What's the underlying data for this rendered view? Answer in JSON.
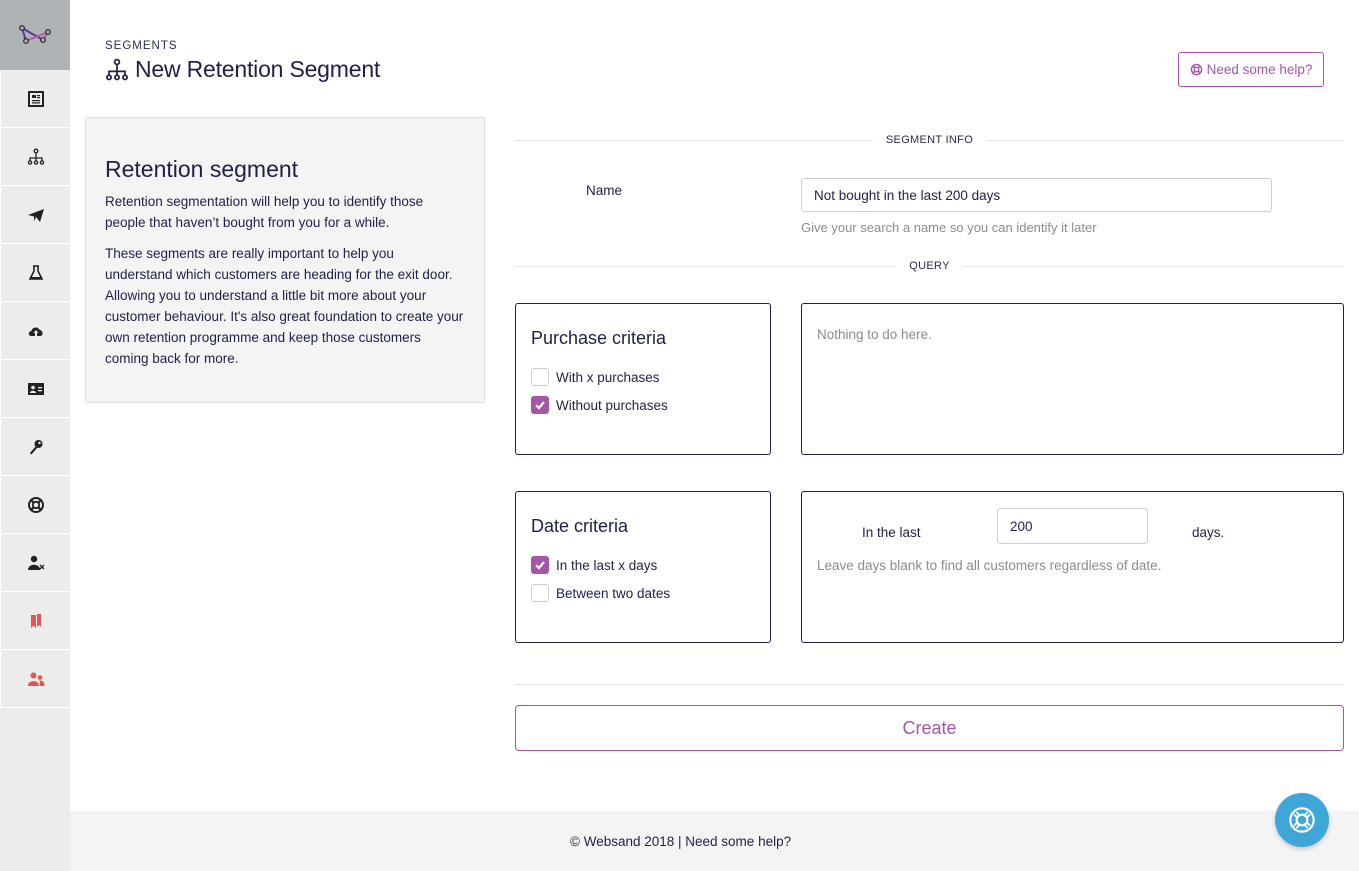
{
  "sidebar": {
    "logo": "websand-logo-icon",
    "items": [
      {
        "icon": "newspaper-icon",
        "color": "#222222"
      },
      {
        "icon": "sitemap-icon",
        "color": "#222222"
      },
      {
        "icon": "paper-plane-icon",
        "color": "#222222"
      },
      {
        "icon": "flask-icon",
        "color": "#222222"
      },
      {
        "icon": "cloud-upload-icon",
        "color": "#222222"
      },
      {
        "icon": "id-card-icon",
        "color": "#222222"
      },
      {
        "icon": "key-icon",
        "color": "#222222"
      },
      {
        "icon": "life-ring-icon",
        "color": "#222222"
      },
      {
        "icon": "user-times-icon",
        "color": "#222222"
      },
      {
        "icon": "bookmarks-icon",
        "color": "#e05555"
      },
      {
        "icon": "users-icon",
        "color": "#e05555"
      }
    ]
  },
  "header": {
    "eyebrow": "SEGMENTS",
    "title": "New Retention Segment",
    "title_icon": "sitemap-icon",
    "help_button": "Need some help?"
  },
  "info_panel": {
    "title": "Retention segment",
    "paragraphs": [
      "Retention segmentation will help you to identify those people that haven’t bought from you for a while.",
      "These segments are really important to help you understand which customers are heading for the exit door. Allowing you to understand a little bit more about your customer behaviour. It's also great foundation to create your own retention programme and keep those customers coming back for more."
    ]
  },
  "form": {
    "segment_info_label": "SEGMENT INFO",
    "name_label": "Name",
    "name_value": "Not bought in the last 200 days",
    "name_help": "Give your search a name so you can identify it later",
    "query_label": "QUERY",
    "purchase_criteria": {
      "title": "Purchase criteria",
      "options": [
        {
          "label": "With x purchases",
          "checked": false
        },
        {
          "label": "Without purchases",
          "checked": true
        }
      ],
      "detail_text": "Nothing to do here."
    },
    "date_criteria": {
      "title": "Date criteria",
      "options": [
        {
          "label": "In the last x days",
          "checked": true
        },
        {
          "label": "Between two dates",
          "checked": false
        }
      ],
      "days_label": "In the last",
      "days_value": "200",
      "days_suffix": "days.",
      "days_help": "Leave days blank to find all customers regardless of date."
    },
    "create_button": "Create"
  },
  "footer": {
    "text": "© Websand 2018 | Need some help?"
  },
  "colors": {
    "accent": "#a656a6",
    "text": "#1f2047",
    "fab": "#3fa7d8",
    "muted": "#8c8c8c"
  }
}
